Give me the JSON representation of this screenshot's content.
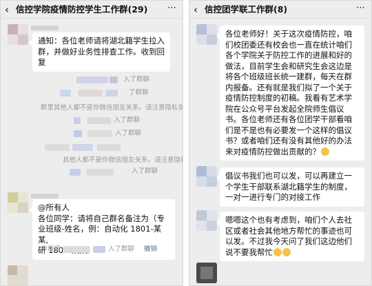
{
  "left_chat": {
    "title": "信控学院疫情防控学生工作群(29)",
    "back_icon": "chevron-left-icon",
    "more_icon": "more-dots-icon",
    "message1": {
      "lines": [
        "通知：各位老师请将湖北籍学生拉入",
        "群，并做好业务性排查工作。收到回",
        "复"
      ]
    },
    "sys1": "入了群聊",
    "sys2": "了群聊",
    "sys3": "群里其他人都不是你微信朋友关系，请注意隐私安全",
    "sys4": "入了群聊",
    "sys5": "入了群聊",
    "sys6": "其他人都不是你微信朋友关系，请注意隐私安全",
    "sys7": "入了群聊",
    "message2": {
      "lines": [
        "@所有人",
        "各位同学：请将自己群名备注为（专",
        "业班级-姓名，例：自动化 1801-某某,",
        "研 1801-某某）"
      ]
    },
    "sys8_prefix": "你邀请",
    "sys8_suffix": "入了群聊",
    "sys8_link": "撤销"
  },
  "right_chat": {
    "title": "信控团学联工作群(8)",
    "back_icon": "chevron-left-icon",
    "more_icon": "more-dots-icon",
    "message1": {
      "lines": [
        "各位老师好！关于这次疫情防控，咱",
        "们校团委还有校会也一直在统计咱们",
        "各个学院关于防控工作的进展和好的",
        "做法，目前学生会和研究生会这边是",
        "将各个班级班长统一建群，每天在群",
        "内报备。还有就是我们拟了一个关于",
        "疫情防控制度的初稿。我看有艺术学",
        "院在公众号平台发起全院师生倡议",
        "书。各位老师还有各位团学干部看咱",
        "们是不是也有必要发一个这样的倡议",
        "书？或者咱们还有没有其他好的办法",
        "来对疫情防控做出贡献的？"
      ]
    },
    "message2": {
      "lines": [
        "倡议书我们也可以发，可以再建立一",
        "个学生干部联系湖北籍学生的制度，",
        "一对一进行专门的对接工作"
      ]
    },
    "message3": {
      "lines": [
        "嗯嗯这个也有考虑到，咱们个人去社",
        "区或者社会其他地方帮忙的事迹也可",
        "以发。不过我今天问了我们这边他们",
        "说不要我帮忙"
      ]
    }
  }
}
